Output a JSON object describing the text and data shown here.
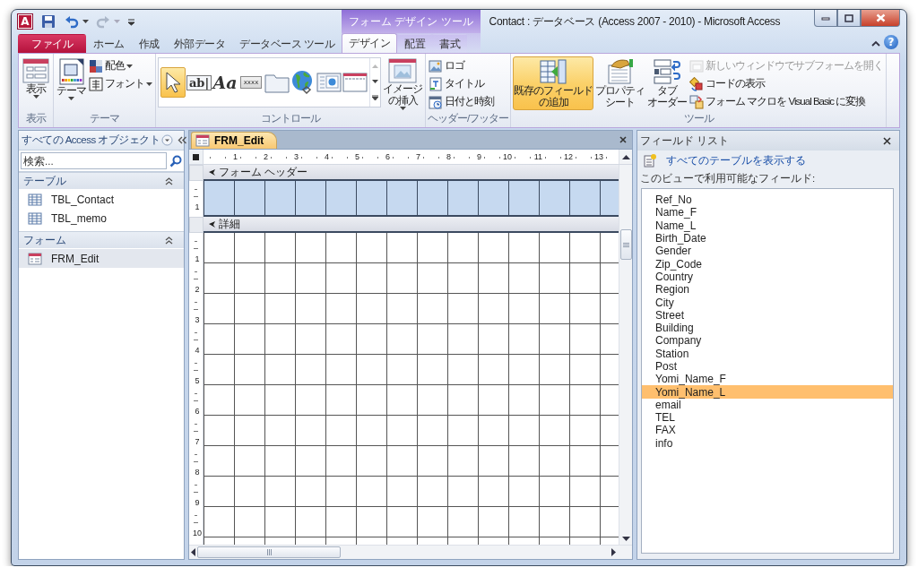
{
  "window": {
    "app_icon": "A",
    "title": "Contact : データベース (Access 2007 - 2010)  -  Microsoft Access",
    "context_tab_group": "フォーム デザイン ツール",
    "help": "?"
  },
  "ribbon_tabs": [
    {
      "label": "ファイル",
      "kind": "file",
      "selected": false
    },
    {
      "label": "ホーム",
      "kind": "normal",
      "selected": false
    },
    {
      "label": "作成",
      "kind": "normal",
      "selected": false
    },
    {
      "label": "外部データ",
      "kind": "normal",
      "selected": false
    },
    {
      "label": "データベース ツール",
      "kind": "normal",
      "selected": false
    },
    {
      "label": "デザイン",
      "kind": "context",
      "selected": true
    },
    {
      "label": "配置",
      "kind": "context",
      "selected": false
    },
    {
      "label": "書式",
      "kind": "context",
      "selected": false
    }
  ],
  "ribbon_groups": [
    {
      "label": "表示",
      "controls": [
        {
          "kind": "large",
          "lines": [
            "表示"
          ],
          "dropdown": true,
          "selected": false
        }
      ]
    },
    {
      "label": "テーマ",
      "controls": [
        {
          "kind": "large",
          "lines": [
            "テーマ"
          ],
          "dropdown": true,
          "selected": false
        },
        {
          "kind": "small",
          "label": "配色",
          "dropdown": true,
          "disabled": false
        },
        {
          "kind": "small",
          "label": "フォント",
          "dropdown": true,
          "disabled": false
        }
      ]
    },
    {
      "label": "コントロール",
      "controls": [
        {
          "kind": "gallery",
          "items": [
            {
              "selected": true
            },
            {
              "glyph": "ab|",
              "selected": false
            },
            {
              "glyph": "Aa",
              "selected": false
            },
            {
              "glyph": "xxxx",
              "selected": false
            },
            {
              "selected": false
            },
            {
              "selected": false
            },
            {
              "selected": false
            },
            {
              "selected": false
            }
          ]
        },
        {
          "kind": "large",
          "lines": [
            "イメージ",
            "の挿入"
          ],
          "dropdown": true,
          "selected": false
        }
      ]
    },
    {
      "label": "ヘッダー/フッター",
      "controls": [
        {
          "kind": "small",
          "label": "ロゴ",
          "disabled": false
        },
        {
          "kind": "small",
          "label": "タイトル",
          "disabled": false
        },
        {
          "kind": "small",
          "label": "日付と時刻",
          "disabled": false
        }
      ]
    },
    {
      "label": "ツール",
      "controls": [
        {
          "kind": "large",
          "lines": [
            "既存のフィールド",
            "の追加"
          ],
          "selected": true
        },
        {
          "kind": "large",
          "lines": [
            "プロパティ",
            "シート"
          ],
          "selected": false
        },
        {
          "kind": "large",
          "lines": [
            "タブ",
            "オーダー"
          ],
          "selected": false
        },
        {
          "kind": "small",
          "label": "新しいウィンドウでサブフォームを開く",
          "disabled": true
        },
        {
          "kind": "small",
          "label": "コードの表示",
          "disabled": false
        },
        {
          "kind": "small",
          "label": "フォーム マクロを Visual Basic に変換",
          "disabled": false
        }
      ]
    }
  ],
  "nav": {
    "title": "すべての Access オブジェクト",
    "search_placeholder": "検索...",
    "groups": [
      {
        "label": "テーブル",
        "expanded": true,
        "items": [
          {
            "label": "TBL_Contact",
            "kind": "table",
            "selected": false
          },
          {
            "label": "TBL_memo",
            "kind": "table",
            "selected": false
          }
        ]
      },
      {
        "label": "フォーム",
        "expanded": true,
        "items": [
          {
            "label": "FRM_Edit",
            "kind": "form",
            "selected": true
          }
        ]
      }
    ]
  },
  "document": {
    "tab": {
      "label": "FRM_Edit",
      "selected": true
    },
    "ruler_marks": [
      "1",
      "2",
      "3",
      "4",
      "5",
      "6",
      "7",
      "8",
      "9",
      "10",
      "11",
      "12",
      "13"
    ],
    "sections": [
      {
        "label": "フォーム ヘッダー",
        "kind": "header",
        "ruler_marks": [
          "1"
        ]
      },
      {
        "label": "詳細",
        "kind": "detail",
        "ruler_marks": [
          "1",
          "2",
          "3",
          "4",
          "5",
          "6",
          "7",
          "8",
          "9",
          "10"
        ]
      }
    ]
  },
  "field_list": {
    "title": "フィールド リスト",
    "link": "すべてのテーブルを表示する",
    "label": "このビューで利用可能なフィールド:",
    "fields": [
      {
        "name": "Ref_No",
        "selected": false
      },
      {
        "name": "Name_F",
        "selected": false
      },
      {
        "name": "Name_L",
        "selected": false
      },
      {
        "name": "Birth_Date",
        "selected": false
      },
      {
        "name": "Gender",
        "selected": false
      },
      {
        "name": "Zip_Code",
        "selected": false
      },
      {
        "name": "Country",
        "selected": false
      },
      {
        "name": "Region",
        "selected": false
      },
      {
        "name": "City",
        "selected": false
      },
      {
        "name": "Street",
        "selected": false
      },
      {
        "name": "Building",
        "selected": false
      },
      {
        "name": "Company",
        "selected": false
      },
      {
        "name": "Station",
        "selected": false
      },
      {
        "name": "Post",
        "selected": false
      },
      {
        "name": "Yomi_Name_F",
        "selected": false
      },
      {
        "name": "Yomi_Name_L",
        "selected": true
      },
      {
        "name": "email",
        "selected": false
      },
      {
        "name": "TEL",
        "selected": false
      },
      {
        "name": "FAX",
        "selected": false
      },
      {
        "name": "info",
        "selected": false
      }
    ]
  }
}
